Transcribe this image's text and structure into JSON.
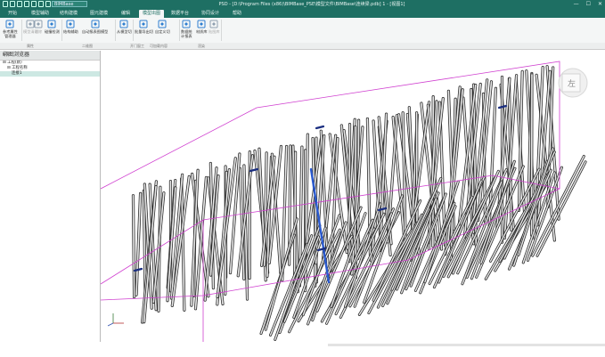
{
  "app": {
    "combo_value": "BIMBase",
    "window_title": "PSD - [D:\\Program Files (x86)\\BIMBase_PSE\\模型文件\\BIMBase\\连续梁.pdb] 1 - [视图1]",
    "minimize_glyph": "—",
    "maximize_glyph": "☐",
    "close_glyph": "✕"
  },
  "tabs": [
    "开始",
    "模型辅助",
    "结构建模",
    "图元建模",
    "编辑",
    "模型出图",
    "数据平台",
    "协同设计",
    "帮助"
  ],
  "active_tab_index": 5,
  "ribbon": {
    "buttons": [
      {
        "label": "参考属性\n管理器",
        "icon": "props-manager-icon",
        "color": "#2f7fd0",
        "disabled": false
      },
      {
        "label": "模型清理",
        "icon": "filter-icon",
        "color": "#8fa0b0",
        "disabled": true
      },
      {
        "label": "消除",
        "icon": "erase-icon",
        "color": "#8fa0b0",
        "disabled": true
      },
      {
        "label": "碰撞检测",
        "icon": "collision-icon",
        "color": "#2f7fd0",
        "disabled": false
      },
      {
        "label": "结构辅助",
        "icon": "cube-icon",
        "color": "#2f7fd0",
        "disabled": false
      },
      {
        "label": "自动报表图模型",
        "icon": "report-icon",
        "color": "#2f7fd0",
        "disabled": false
      },
      {
        "label": "从模型切",
        "icon": "cut-icon",
        "color": "#2f7fd0",
        "disabled": false
      },
      {
        "label": "批量导出切",
        "icon": "export-icon",
        "color": "#2f7fd0",
        "disabled": false
      },
      {
        "label": "自定义切",
        "icon": "custom-cut-icon",
        "color": "#2f7fd0",
        "disabled": false
      },
      {
        "label": "数据统\n计报表",
        "icon": "stats-icon",
        "color": "#2f7fd0",
        "disabled": false
      },
      {
        "label": "材质库",
        "icon": "material-icon",
        "color": "#2f7fd0",
        "disabled": false
      },
      {
        "label": "贴图库",
        "icon": "texture-icon",
        "color": "#8fa0b0",
        "disabled": true
      }
    ],
    "groups": [
      "属性",
      "二维图",
      "开门窗工",
      "可加载内容",
      "渲染"
    ]
  },
  "panel": {
    "title": "绑图浏览器",
    "controls": "▾ ✕",
    "tree": [
      {
        "text": "⊟ 工程(默)",
        "indent": 0,
        "selected": false
      },
      {
        "text": "⊟ 工程名称",
        "indent": 1,
        "selected": false
      },
      {
        "text": "连接1",
        "indent": 2,
        "selected": true
      }
    ]
  },
  "viewcube": {
    "face_label": "左"
  },
  "colors": {
    "titlebar": "#1e6f63",
    "ribbon": "#f4f6f6",
    "accent": "#2f7fd0",
    "bounding_box": "#d040d0",
    "bar_stroke": "#2e2e2e",
    "bar_fill": "#e8e8e8",
    "highlight": "#2a5ad0"
  }
}
